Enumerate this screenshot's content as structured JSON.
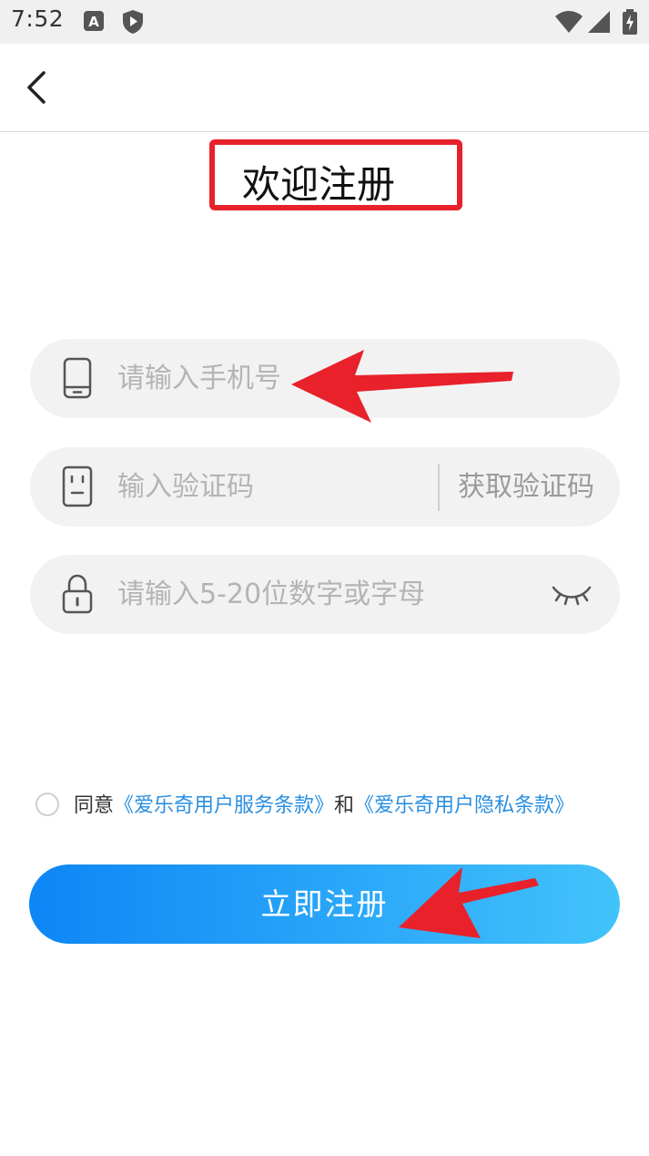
{
  "status_bar": {
    "time": "7:52"
  },
  "header": {
    "back_icon": "chevron-left-icon"
  },
  "title": "欢迎注册",
  "form": {
    "phone_placeholder": "请输入手机号",
    "code_placeholder": "输入验证码",
    "get_code_label": "获取验证码",
    "password_placeholder": "请输入5-20位数字或字母"
  },
  "agreement": {
    "prefix": "同意",
    "service_terms": "《爱乐奇用户服务条款》",
    "and": "和",
    "privacy_terms": "《爱乐奇用户隐私条款》"
  },
  "register_label": "立即注册",
  "colors": {
    "annotation_red": "#e8212b",
    "link_blue": "#2a8fe0",
    "button_gradient_start": "#0d86f6",
    "button_gradient_end": "#43c3fb"
  }
}
